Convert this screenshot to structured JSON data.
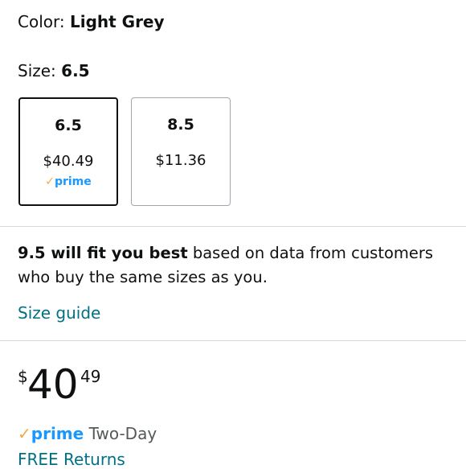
{
  "color": {
    "label": "Color:",
    "value": "Light Grey"
  },
  "size": {
    "label": "Size:",
    "value": "6.5"
  },
  "size_options": [
    {
      "size": "6.5",
      "price": "$40.49",
      "prime_check": "✓",
      "prime_label": "prime",
      "selected": true
    },
    {
      "size": "8.5",
      "price": "$11.36",
      "selected": false
    }
  ],
  "fit": {
    "bold": "9.5 will fit you best",
    "rest": " based on data from customers who buy the same sizes as you."
  },
  "size_guide": "Size guide",
  "price": {
    "symbol": "$",
    "whole": "40",
    "fraction": "49"
  },
  "delivery": {
    "check": "✓",
    "prime": "prime",
    "text": " Two-Day"
  },
  "free_returns": "FREE Returns",
  "colors": {
    "link": "#007185",
    "prime_blue": "#1a98ff",
    "prime_check": "#f3a847"
  }
}
